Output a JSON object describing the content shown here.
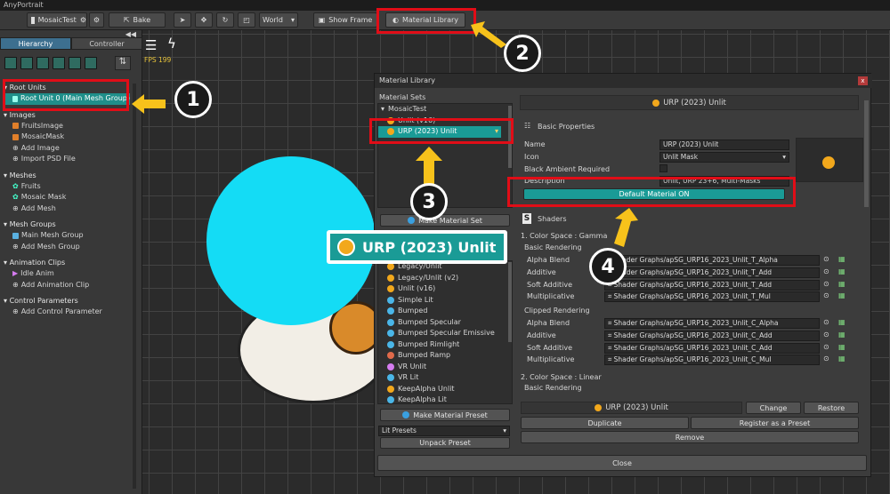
{
  "app_title": "AnyPortrait",
  "toolbar": {
    "project": "MosaicTest",
    "bake": "Bake",
    "world": "World",
    "show_frame": "Show Frame",
    "material_library": "Material Library"
  },
  "left": {
    "tab_hierarchy": "Hierarchy",
    "tab_controller": "Controller",
    "sections": [
      {
        "title": "Root Units",
        "items": [
          "Root Unit 0 (Main Mesh Group)"
        ]
      },
      {
        "title": "Images",
        "items": [
          "FruitsImage",
          "MosaicMask",
          "Add Image",
          "Import PSD File"
        ]
      },
      {
        "title": "Meshes",
        "items": [
          "Fruits",
          "Mosaic Mask",
          "Add Mesh"
        ]
      },
      {
        "title": "Mesh Groups",
        "items": [
          "Main Mesh Group",
          "Add Mesh Group"
        ]
      },
      {
        "title": "Animation Clips",
        "items": [
          "Idle Anim",
          "Add Animation Clip"
        ]
      },
      {
        "title": "Control Parameters",
        "items": [
          "Add Control Parameter"
        ]
      }
    ]
  },
  "fps": "FPS 199",
  "dialog": {
    "title": "Material Library",
    "material_sets_label": "Material Sets",
    "sets_root": "MosaicTest",
    "sets": [
      "Unlit (v16)",
      "URP (2023) Unlit"
    ],
    "make_set": "Make Material Set",
    "presets": [
      "Legacy/Unlit",
      "Legacy/Unlit (v2)",
      "Unlit (v16)",
      "Simple Lit",
      "Bumped",
      "Bumped Specular",
      "Bumped Specular Emissive",
      "Bumped Rimlight",
      "Bumped Ramp",
      "VR Unlit",
      "VR Lit",
      "KeepAlpha Unlit",
      "KeepAlpha Lit"
    ],
    "make_preset": "Make Material Preset",
    "lit_presets": "Lit Presets",
    "unpack_preset": "Unpack Preset",
    "header_name": "URP (2023) Unlit",
    "basic_properties": "Basic Properties",
    "name_label": "Name",
    "name_value": "URP (2023) Unlit",
    "icon_label": "Icon",
    "icon_value": "Unlit Mask",
    "black_ambient": "Black Ambient Required",
    "description_label": "Description",
    "description_value": "Unlit, URP 23+6, Multi-Masks",
    "default_material": "Default Material ON",
    "shaders": "Shaders",
    "cs_gamma": "1. Color Space : Gamma",
    "basic_rendering": "Basic Rendering",
    "clipped_rendering": "Clipped Rendering",
    "cs_linear": "2. Color Space : Linear",
    "basic_rows": [
      {
        "label": "Alpha Blend",
        "value": "Shader Graphs/apSG_URP16_2023_Unlit_T_Alpha"
      },
      {
        "label": "Additive",
        "value": "Shader Graphs/apSG_URP16_2023_Unlit_T_Add"
      },
      {
        "label": "Soft Additive",
        "value": "Shader Graphs/apSG_URP16_2023_Unlit_T_Add"
      },
      {
        "label": "Multiplicative",
        "value": "Shader Graphs/apSG_URP16_2023_Unlit_T_Mul"
      }
    ],
    "clipped_rows": [
      {
        "label": "Alpha Blend",
        "value": "Shader Graphs/apSG_URP16_2023_Unlit_C_Alpha"
      },
      {
        "label": "Additive",
        "value": "Shader Graphs/apSG_URP16_2023_Unlit_C_Add"
      },
      {
        "label": "Soft Additive",
        "value": "Shader Graphs/apSG_URP16_2023_Unlit_C_Add"
      },
      {
        "label": "Multiplicative",
        "value": "Shader Graphs/apSG_URP16_2023_Unlit_C_Mul"
      }
    ],
    "footer_name": "URP (2023) Unlit",
    "change": "Change",
    "restore": "Restore",
    "duplicate": "Duplicate",
    "register": "Register as a Preset",
    "remove": "Remove",
    "close": "Close"
  },
  "zoom_label": "URP (2023) Unlit",
  "callouts": [
    "1",
    "2",
    "3",
    "4"
  ],
  "colors": {
    "accent": "#e10d17",
    "arrow": "#f7c21b",
    "teal": "#1a9b96",
    "cyan_disc": "#14dcf5"
  }
}
